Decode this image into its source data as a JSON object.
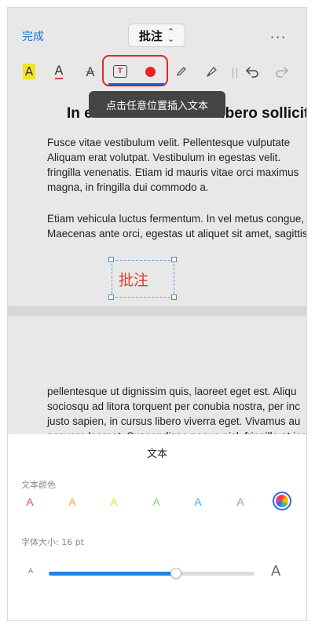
{
  "header": {
    "done_label": "完成",
    "mode_label": "批注",
    "more_label": "···"
  },
  "toolbar": {
    "highlight_glyph": "A",
    "underline_glyph": "A",
    "strike_glyph": "A",
    "textbox_glyph": "T",
    "divider_glyph": "||"
  },
  "tooltip": "点击任意位置插入文本",
  "document": {
    "title": "In eleifend velit vitae libero sollicitudin",
    "para1": [
      "Fusce vitae vestibulum velit. Pellentesque vulputate",
      "Aliquam erat volutpat. Vestibulum in egestas velit.",
      "fringilla venenatis. Etiam id mauris vitae orci maximus",
      "magna, in fringilla dui commodo a."
    ],
    "para2": [
      "Etiam vehicula luctus fermentum. In vel metus congue,",
      "Maecenas ante orci, egestas ut aliquet sit amet, sagittis"
    ],
    "annotation_text": "批注",
    "page2": [
      "pellentesque ut dignissim quis, laoreet eget est. Aliqu",
      "sociosqu ad litora torquent per conubia nostra, per inc",
      "justo sapien, in cursus libero viverra eget. Vivamus au",
      "posuere laoreet. Suspendisse neque nisl, fringilla at iac"
    ]
  },
  "sheet": {
    "title": "文本",
    "color_label": "文本颜色",
    "size_label": "字体大小: 16 pt",
    "swatch_glyph": "A",
    "swatches": [
      "#e84a4a",
      "#f0a92b",
      "#ecd82c",
      "#7fd37a",
      "#3eaee8",
      "#a98ad6"
    ],
    "size_small_glyph": "A",
    "size_large_glyph": "A",
    "font_size_fraction": 0.62
  },
  "colors": {
    "accent": "#1e73d8",
    "selection_border": "#e52424",
    "annotation_text": "#e03a3a",
    "slider_fill": "#1f83e8"
  }
}
